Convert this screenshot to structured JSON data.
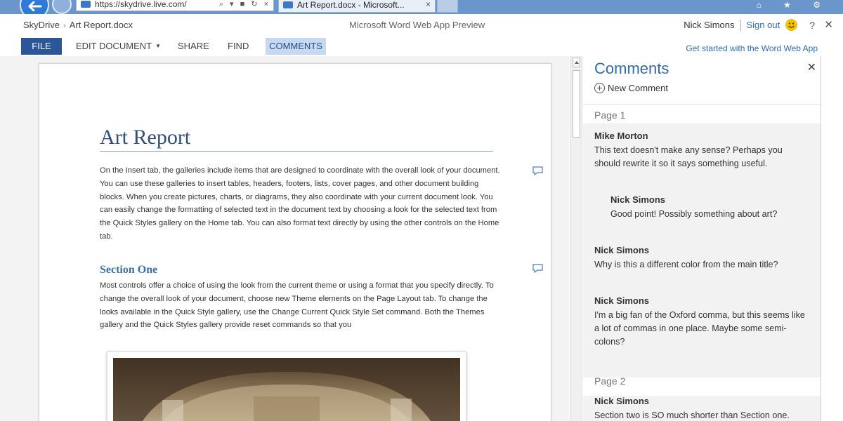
{
  "browser": {
    "address": "https://skydrive.live.com/",
    "address_actions": "⌕ ▾ ■ ↻ ×",
    "tab_title": "Art Report.docx - Microsoft...",
    "tab_close": "×",
    "window_icons": "⌂ ★ ⚙"
  },
  "header": {
    "breadcrumb_root": "SkyDrive",
    "breadcrumb_sep": "›",
    "breadcrumb_file": "Art Report.docx",
    "app_title": "Microsoft Word Web App Preview",
    "user_name": "Nick Simons",
    "sign_out": "Sign out",
    "help": "?",
    "close": "✕"
  },
  "ribbon": {
    "file": "FILE",
    "edit_document": "EDIT DOCUMENT",
    "share": "SHARE",
    "find": "FIND",
    "comments": "COMMENTS",
    "get_started": "Get started with the Word Web App"
  },
  "document": {
    "title": "Art Report",
    "paragraph1": "On the Insert tab, the galleries include items that are designed to coordinate with the overall look of your document. You can use these galleries to insert tables, headers, footers, lists, cover pages, and other document building blocks. When you create pictures, charts, or diagrams, they also coordinate with your current document look. You can easily change the formatting of selected text in the document text by choosing a look for the selected text from the Quick Styles gallery on the Home tab. You can also format text directly by using the other controls on the Home tab.",
    "section_heading": "Section One",
    "paragraph2": "Most controls offer a choice of using the look from the current theme or using a format that you specify directly. To change the overall look of your document, choose new Theme elements on the Page Layout tab. To change the looks available in the Quick Style gallery, use the Change Current Quick Style Set command. Both the Themes gallery and the Quick Styles gallery provide reset commands so that you"
  },
  "comments_pane": {
    "title": "Comments",
    "close": "✕",
    "new_comment": "New Comment",
    "page1_label": "Page 1",
    "page2_label": "Page 2",
    "comments": [
      {
        "author": "Mike Morton",
        "text": "This text doesn't make any sense?  Perhaps you should rewrite it so it says something useful."
      },
      {
        "author": "Nick Simons",
        "text": "Good point! Possibly something about art?"
      },
      {
        "author": "Nick Simons",
        "text": "Why is this a different color from the main title?"
      },
      {
        "author": "Nick Simons",
        "text": "I'm a big fan of the Oxford comma, but this seems like a lot of commas in one place. Maybe some semi-colons?"
      },
      {
        "author": "Nick Simons",
        "text": "Section two is SO much shorter than Section one."
      }
    ]
  },
  "colors": {
    "accent": "#2b579a",
    "link": "#2a6ebd",
    "comments_tab_bg": "#c5daf2"
  }
}
